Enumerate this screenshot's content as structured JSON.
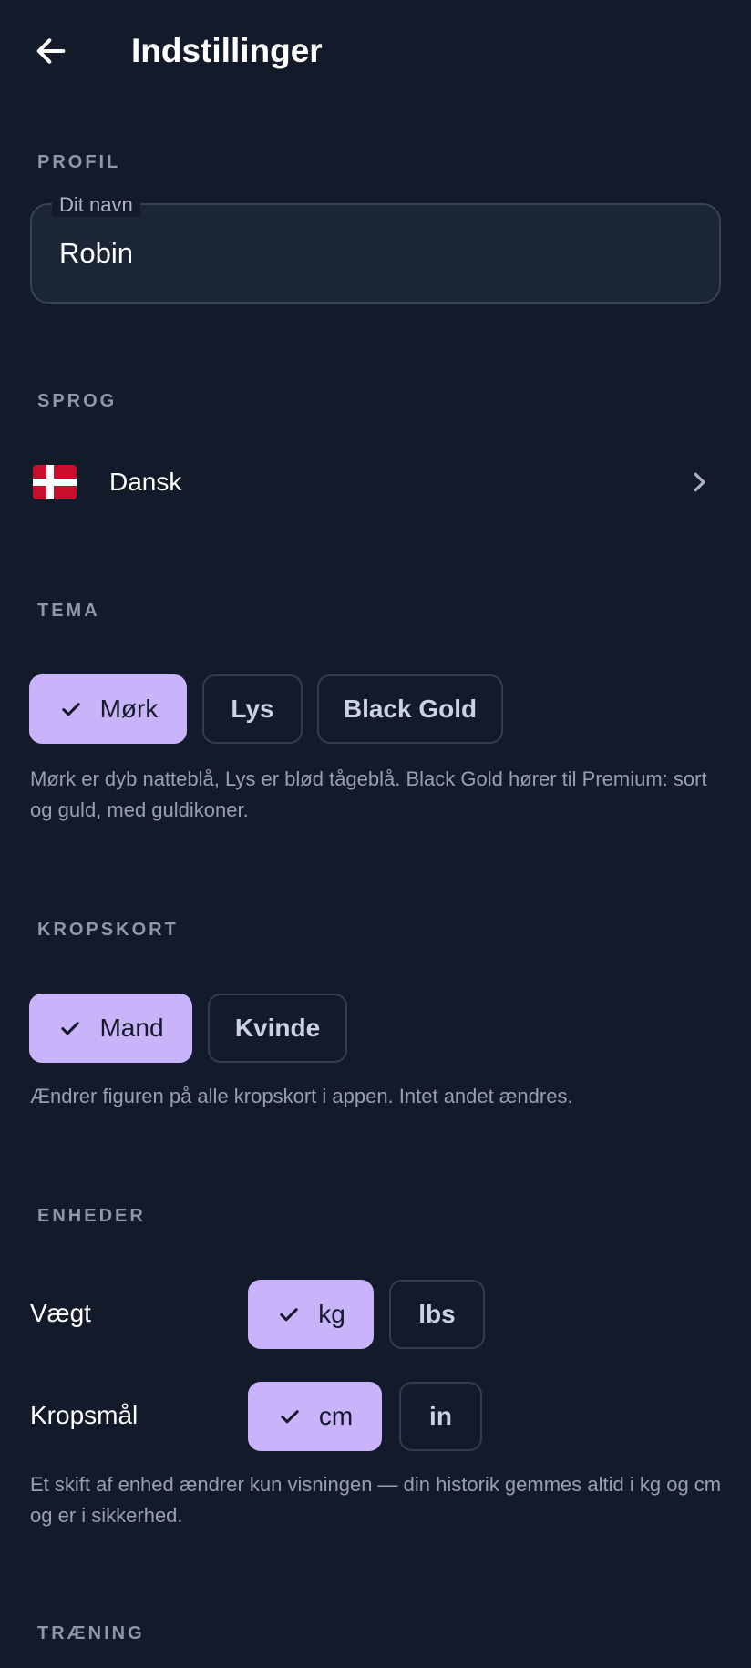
{
  "header": {
    "title": "Indstillinger",
    "back_icon": "arrow-left-icon"
  },
  "profile": {
    "section_label": "PROFIL",
    "name_label": "Dit navn",
    "name_value": "Robin"
  },
  "language": {
    "section_label": "SPROG",
    "flag_icon": "denmark-flag-icon",
    "current": "Dansk",
    "chevron_icon": "chevron-right-icon"
  },
  "theme": {
    "section_label": "TEMA",
    "options": [
      {
        "label": "Mørk",
        "selected": true
      },
      {
        "label": "Lys",
        "selected": false
      },
      {
        "label": "Black Gold",
        "selected": false
      }
    ],
    "helper": "Mørk er dyb natteblå, Lys er blød tågeblå. Black Gold hører til Premium: sort og guld, med guldikoner."
  },
  "body_map": {
    "section_label": "KROPSKORT",
    "options": [
      {
        "label": "Mand",
        "selected": true
      },
      {
        "label": "Kvinde",
        "selected": false
      }
    ],
    "helper": "Ændrer figuren på alle kropskort i appen. Intet andet ændres."
  },
  "units": {
    "section_label": "ENHEDER",
    "weight": {
      "label": "Vægt",
      "options": [
        {
          "label": "kg",
          "selected": true
        },
        {
          "label": "lbs",
          "selected": false
        }
      ]
    },
    "measurements": {
      "label": "Kropsmål",
      "options": [
        {
          "label": "cm",
          "selected": true
        },
        {
          "label": "in",
          "selected": false
        }
      ]
    },
    "helper": "Et skift af enhed ændrer kun visningen — din historik gemmes altid i kg og cm og er i sikkerhed."
  },
  "training": {
    "section_label": "TRÆNING"
  },
  "colors": {
    "background": "#131a2a",
    "accent": "#c9b3fb",
    "muted_text": "#97a0b3"
  }
}
